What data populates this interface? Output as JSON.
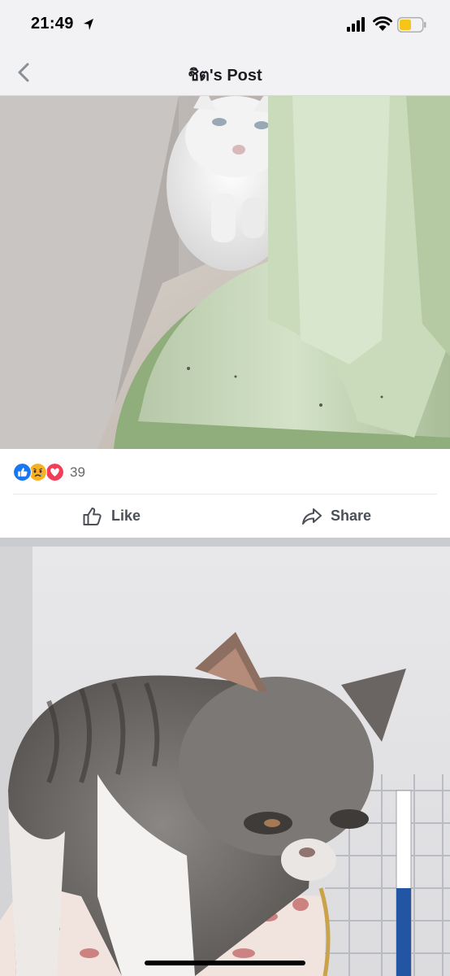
{
  "status_bar": {
    "time": "21:49",
    "icons": [
      "location-arrow-icon",
      "cellular-signal-icon",
      "wifi-icon",
      "battery-icon"
    ],
    "battery_color": "#f5c518"
  },
  "nav": {
    "title": "ชิต's Post",
    "back_icon": "chevron-left-icon"
  },
  "post": {
    "photos": [
      {
        "subject": "white cat in a corner behind a green fan stand"
      },
      {
        "subject": "thin grey tabby and white kitten on a cushion"
      }
    ],
    "reactions": {
      "types": [
        "like",
        "sad",
        "love"
      ],
      "count": "39",
      "colors": {
        "like": "#1877f2",
        "sad": "#f7b125",
        "love": "#f33e58"
      }
    },
    "actions": {
      "like_label": "Like",
      "share_label": "Share",
      "like_icon": "thumbs-up-icon",
      "share_icon": "share-arrow-icon"
    }
  }
}
